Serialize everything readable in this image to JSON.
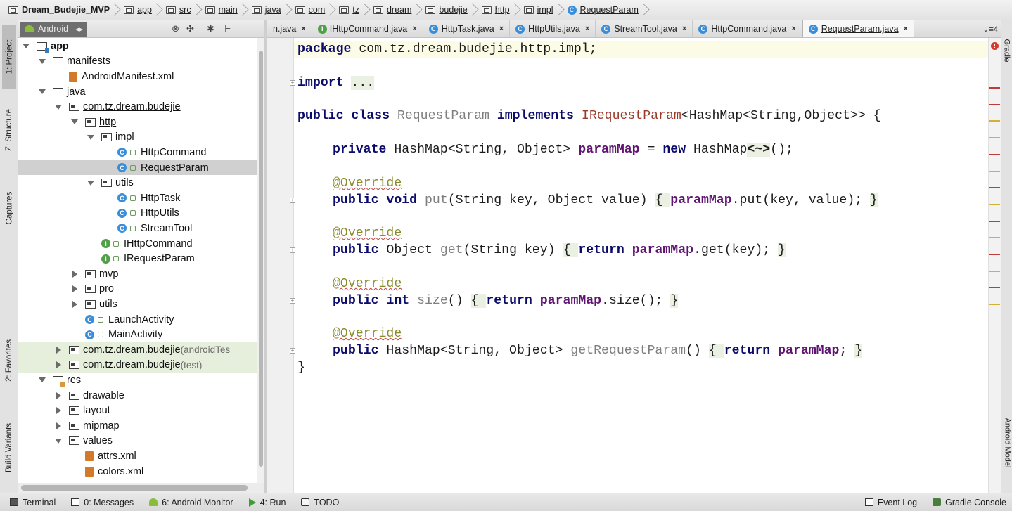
{
  "breadcrumb": [
    "Dream_Budejie_MVP",
    "app",
    "src",
    "main",
    "java",
    "com",
    "tz",
    "dream",
    "budejie",
    "http",
    "impl",
    "RequestParam"
  ],
  "left_tool_tabs": [
    "1: Project",
    "Z: Structure",
    "Captures",
    "2: Favorites",
    "Build Variants"
  ],
  "right_tool_tabs": [
    "Gradle",
    "Android Model"
  ],
  "project_toolbar": {
    "view": "Android",
    "icons": [
      "view-dropdown-icon",
      "sync-icon",
      "scroll-icon",
      "settings-icon",
      "collapse-icon"
    ]
  },
  "project_tree": [
    {
      "label": "app",
      "depth": 0,
      "arrow": "down",
      "icon": "module"
    },
    {
      "label": "manifests",
      "depth": 1,
      "arrow": "down",
      "icon": "folder"
    },
    {
      "label": "AndroidManifest.xml",
      "depth": 2,
      "arrow": "none",
      "icon": "xml"
    },
    {
      "label": "java",
      "depth": 1,
      "arrow": "down",
      "icon": "folder"
    },
    {
      "label": "com.tz.dream.budejie",
      "depth": 2,
      "arrow": "down",
      "icon": "package",
      "underline": true
    },
    {
      "label": "http",
      "depth": 3,
      "arrow": "down",
      "icon": "package",
      "underline": true
    },
    {
      "label": "impl",
      "depth": 4,
      "arrow": "down",
      "icon": "package",
      "underline": true
    },
    {
      "label": "HttpCommand",
      "depth": 5,
      "arrow": "none",
      "icon": "class"
    },
    {
      "label": "RequestParam",
      "depth": 5,
      "arrow": "none",
      "icon": "class",
      "selected": true,
      "underline": true
    },
    {
      "label": "utils",
      "depth": 4,
      "arrow": "down",
      "icon": "package"
    },
    {
      "label": "HttpTask",
      "depth": 5,
      "arrow": "none",
      "icon": "class"
    },
    {
      "label": "HttpUtils",
      "depth": 5,
      "arrow": "none",
      "icon": "class"
    },
    {
      "label": "StreamTool",
      "depth": 5,
      "arrow": "none",
      "icon": "class"
    },
    {
      "label": "IHttpCommand",
      "depth": 4,
      "arrow": "none",
      "icon": "interface"
    },
    {
      "label": "IRequestParam",
      "depth": 4,
      "arrow": "none",
      "icon": "interface"
    },
    {
      "label": "mvp",
      "depth": 3,
      "arrow": "right",
      "icon": "package"
    },
    {
      "label": "pro",
      "depth": 3,
      "arrow": "right",
      "icon": "package"
    },
    {
      "label": "utils",
      "depth": 3,
      "arrow": "right",
      "icon": "package"
    },
    {
      "label": "LaunchActivity",
      "depth": 3,
      "arrow": "none",
      "icon": "class"
    },
    {
      "label": "MainActivity",
      "depth": 3,
      "arrow": "none",
      "icon": "class"
    },
    {
      "label": "com.tz.dream.budejie",
      "suffix": " (androidTes",
      "depth": 2,
      "arrow": "right",
      "icon": "package",
      "test": true
    },
    {
      "label": "com.tz.dream.budejie",
      "suffix": " (test)",
      "depth": 2,
      "arrow": "right",
      "icon": "package",
      "test": true
    },
    {
      "label": "res",
      "depth": 1,
      "arrow": "down",
      "icon": "res"
    },
    {
      "label": "drawable",
      "depth": 2,
      "arrow": "right",
      "icon": "package"
    },
    {
      "label": "layout",
      "depth": 2,
      "arrow": "right",
      "icon": "package"
    },
    {
      "label": "mipmap",
      "depth": 2,
      "arrow": "right",
      "icon": "package"
    },
    {
      "label": "values",
      "depth": 2,
      "arrow": "down",
      "icon": "package"
    },
    {
      "label": "attrs.xml",
      "depth": 3,
      "arrow": "none",
      "icon": "xml"
    },
    {
      "label": "colors.xml",
      "depth": 3,
      "arrow": "none",
      "icon": "xml"
    }
  ],
  "editor_tabs": [
    {
      "label": "n.java",
      "icon": "none",
      "close": "×"
    },
    {
      "label": "IHttpCommand.java",
      "icon": "interface",
      "close": "×"
    },
    {
      "label": "HttpTask.java",
      "icon": "class",
      "close": "×"
    },
    {
      "label": "HttpUtils.java",
      "icon": "class",
      "close": "×"
    },
    {
      "label": "StreamTool.java",
      "icon": "class",
      "close": "×"
    },
    {
      "label": "HttpCommand.java",
      "icon": "class",
      "close": "×"
    },
    {
      "label": "RequestParam.java",
      "icon": "class",
      "close": "×",
      "active": true
    }
  ],
  "tab_overflow": "⌄≡4",
  "code": {
    "l1": [
      "package",
      " com.tz.dream.budejie.http.impl;"
    ],
    "l2": [
      "import",
      " ",
      "..."
    ],
    "l3": [
      "public",
      " ",
      "class",
      " ",
      "RequestParam",
      " ",
      "implements",
      " ",
      "IRequestParam",
      "<HashMap<String,Object>> {"
    ],
    "l4": [
      "private",
      " HashMap<String, Object> ",
      "paramMap",
      " = ",
      "new",
      " HashMap",
      "<~>",
      "();"
    ],
    "l5": "@Override",
    "l6": [
      "public",
      " ",
      "void",
      " ",
      "put",
      "(String key, Object value) ",
      "{ ",
      "paramMap",
      ".put(key, value); ",
      "}"
    ],
    "l7": "@Override",
    "l8": [
      "public",
      " Object ",
      "get",
      "(String key) ",
      "{ ",
      "return",
      " ",
      "paramMap",
      ".get(key); ",
      "}"
    ],
    "l9": "@Override",
    "l10": [
      "public",
      " ",
      "int",
      " ",
      "size",
      "() ",
      "{ ",
      "return",
      " ",
      "paramMap",
      ".size(); ",
      "}"
    ],
    "l11": "@Override",
    "l12": [
      "public",
      " HashMap<String, Object> ",
      "getRequestParam",
      "() ",
      "{ ",
      "return",
      " ",
      "paramMap",
      "; ",
      "}"
    ],
    "l13": "}"
  },
  "error_stripe": {
    "error_icon": "!",
    "marks": [
      {
        "color": "#c23a3a",
        "line": 3
      },
      {
        "color": "#c23a3a",
        "line": 4
      },
      {
        "color": "#d2b230",
        "line": 5
      },
      {
        "color": "#d2b230",
        "line": 6
      },
      {
        "color": "#c23a3a",
        "line": 7
      },
      {
        "color": "#d2b230",
        "line": 8
      },
      {
        "color": "#c23a3a",
        "line": 9
      },
      {
        "color": "#d2b230",
        "line": 10
      },
      {
        "color": "#c23a3a",
        "line": 11
      },
      {
        "color": "#d2b230",
        "line": 12
      },
      {
        "color": "#c23a3a",
        "line": 13
      },
      {
        "color": "#d2b230",
        "line": 14
      },
      {
        "color": "#c23a3a",
        "line": 15
      },
      {
        "color": "#d2b230",
        "line": 16
      }
    ]
  },
  "status_bar": {
    "left": [
      {
        "label": "Terminal",
        "icon": "term"
      },
      {
        "label": "0: Messages",
        "icon": "msg"
      },
      {
        "label": "6: Android Monitor",
        "icon": "mon"
      },
      {
        "label": "4: Run",
        "icon": "run"
      },
      {
        "label": "TODO",
        "icon": "todo"
      }
    ],
    "right": [
      {
        "label": "Event Log",
        "icon": "log"
      },
      {
        "label": "Gradle Console",
        "icon": "gradle"
      }
    ]
  },
  "colors": {
    "keyword": "#0b0b6b",
    "field": "#5e1470",
    "annotation": "#8a8a2a",
    "selection": "#d0d0d0",
    "current_line": "#fcfbe6"
  }
}
